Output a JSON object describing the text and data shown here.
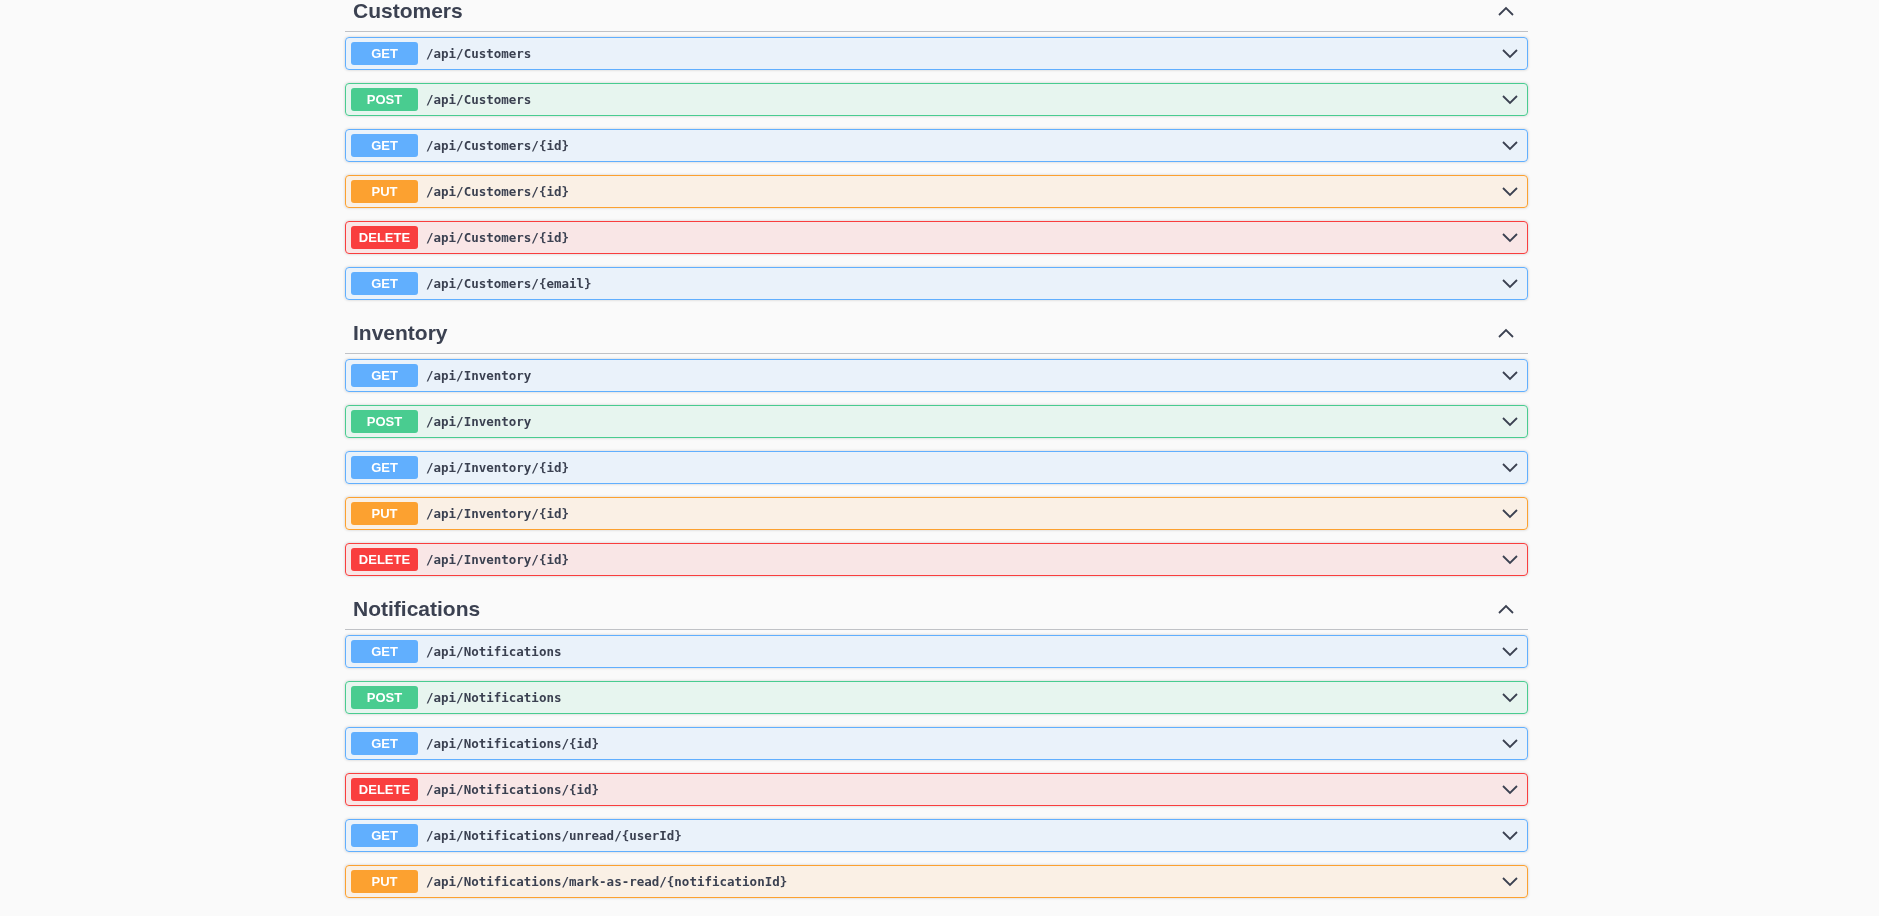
{
  "sections": [
    {
      "title": "Customers",
      "expanded": true,
      "operations": [
        {
          "method": "GET",
          "color": "#61affe",
          "path": "/api/Customers",
          "expanded": false
        },
        {
          "method": "POST",
          "color": "#49cc90",
          "path": "/api/Customers",
          "expanded": false
        },
        {
          "method": "GET",
          "color": "#61affe",
          "path": "/api/Customers/{id}",
          "expanded": false
        },
        {
          "method": "PUT",
          "color": "#fca130",
          "path": "/api/Customers/{id}",
          "expanded": false
        },
        {
          "method": "DELETE",
          "color": "#f93e3e",
          "path": "/api/Customers/{id}",
          "expanded": false
        },
        {
          "method": "GET",
          "color": "#61affe",
          "path": "/api/Customers/{email}",
          "expanded": false
        }
      ]
    },
    {
      "title": "Inventory",
      "expanded": true,
      "operations": [
        {
          "method": "GET",
          "color": "#61affe",
          "path": "/api/Inventory",
          "expanded": false
        },
        {
          "method": "POST",
          "color": "#49cc90",
          "path": "/api/Inventory",
          "expanded": false
        },
        {
          "method": "GET",
          "color": "#61affe",
          "path": "/api/Inventory/{id}",
          "expanded": false
        },
        {
          "method": "PUT",
          "color": "#fca130",
          "path": "/api/Inventory/{id}",
          "expanded": false
        },
        {
          "method": "DELETE",
          "color": "#f93e3e",
          "path": "/api/Inventory/{id}",
          "expanded": false
        }
      ]
    },
    {
      "title": "Notifications",
      "expanded": true,
      "operations": [
        {
          "method": "GET",
          "color": "#61affe",
          "path": "/api/Notifications",
          "expanded": false
        },
        {
          "method": "POST",
          "color": "#49cc90",
          "path": "/api/Notifications",
          "expanded": false
        },
        {
          "method": "GET",
          "color": "#61affe",
          "path": "/api/Notifications/{id}",
          "expanded": false
        },
        {
          "method": "DELETE",
          "color": "#f93e3e",
          "path": "/api/Notifications/{id}",
          "expanded": false
        },
        {
          "method": "GET",
          "color": "#61affe",
          "path": "/api/Notifications/unread/{userId}",
          "expanded": false
        },
        {
          "method": "PUT",
          "color": "#fca130",
          "path": "/api/Notifications/mark-as-read/{notificationId}",
          "expanded": false
        }
      ]
    }
  ]
}
